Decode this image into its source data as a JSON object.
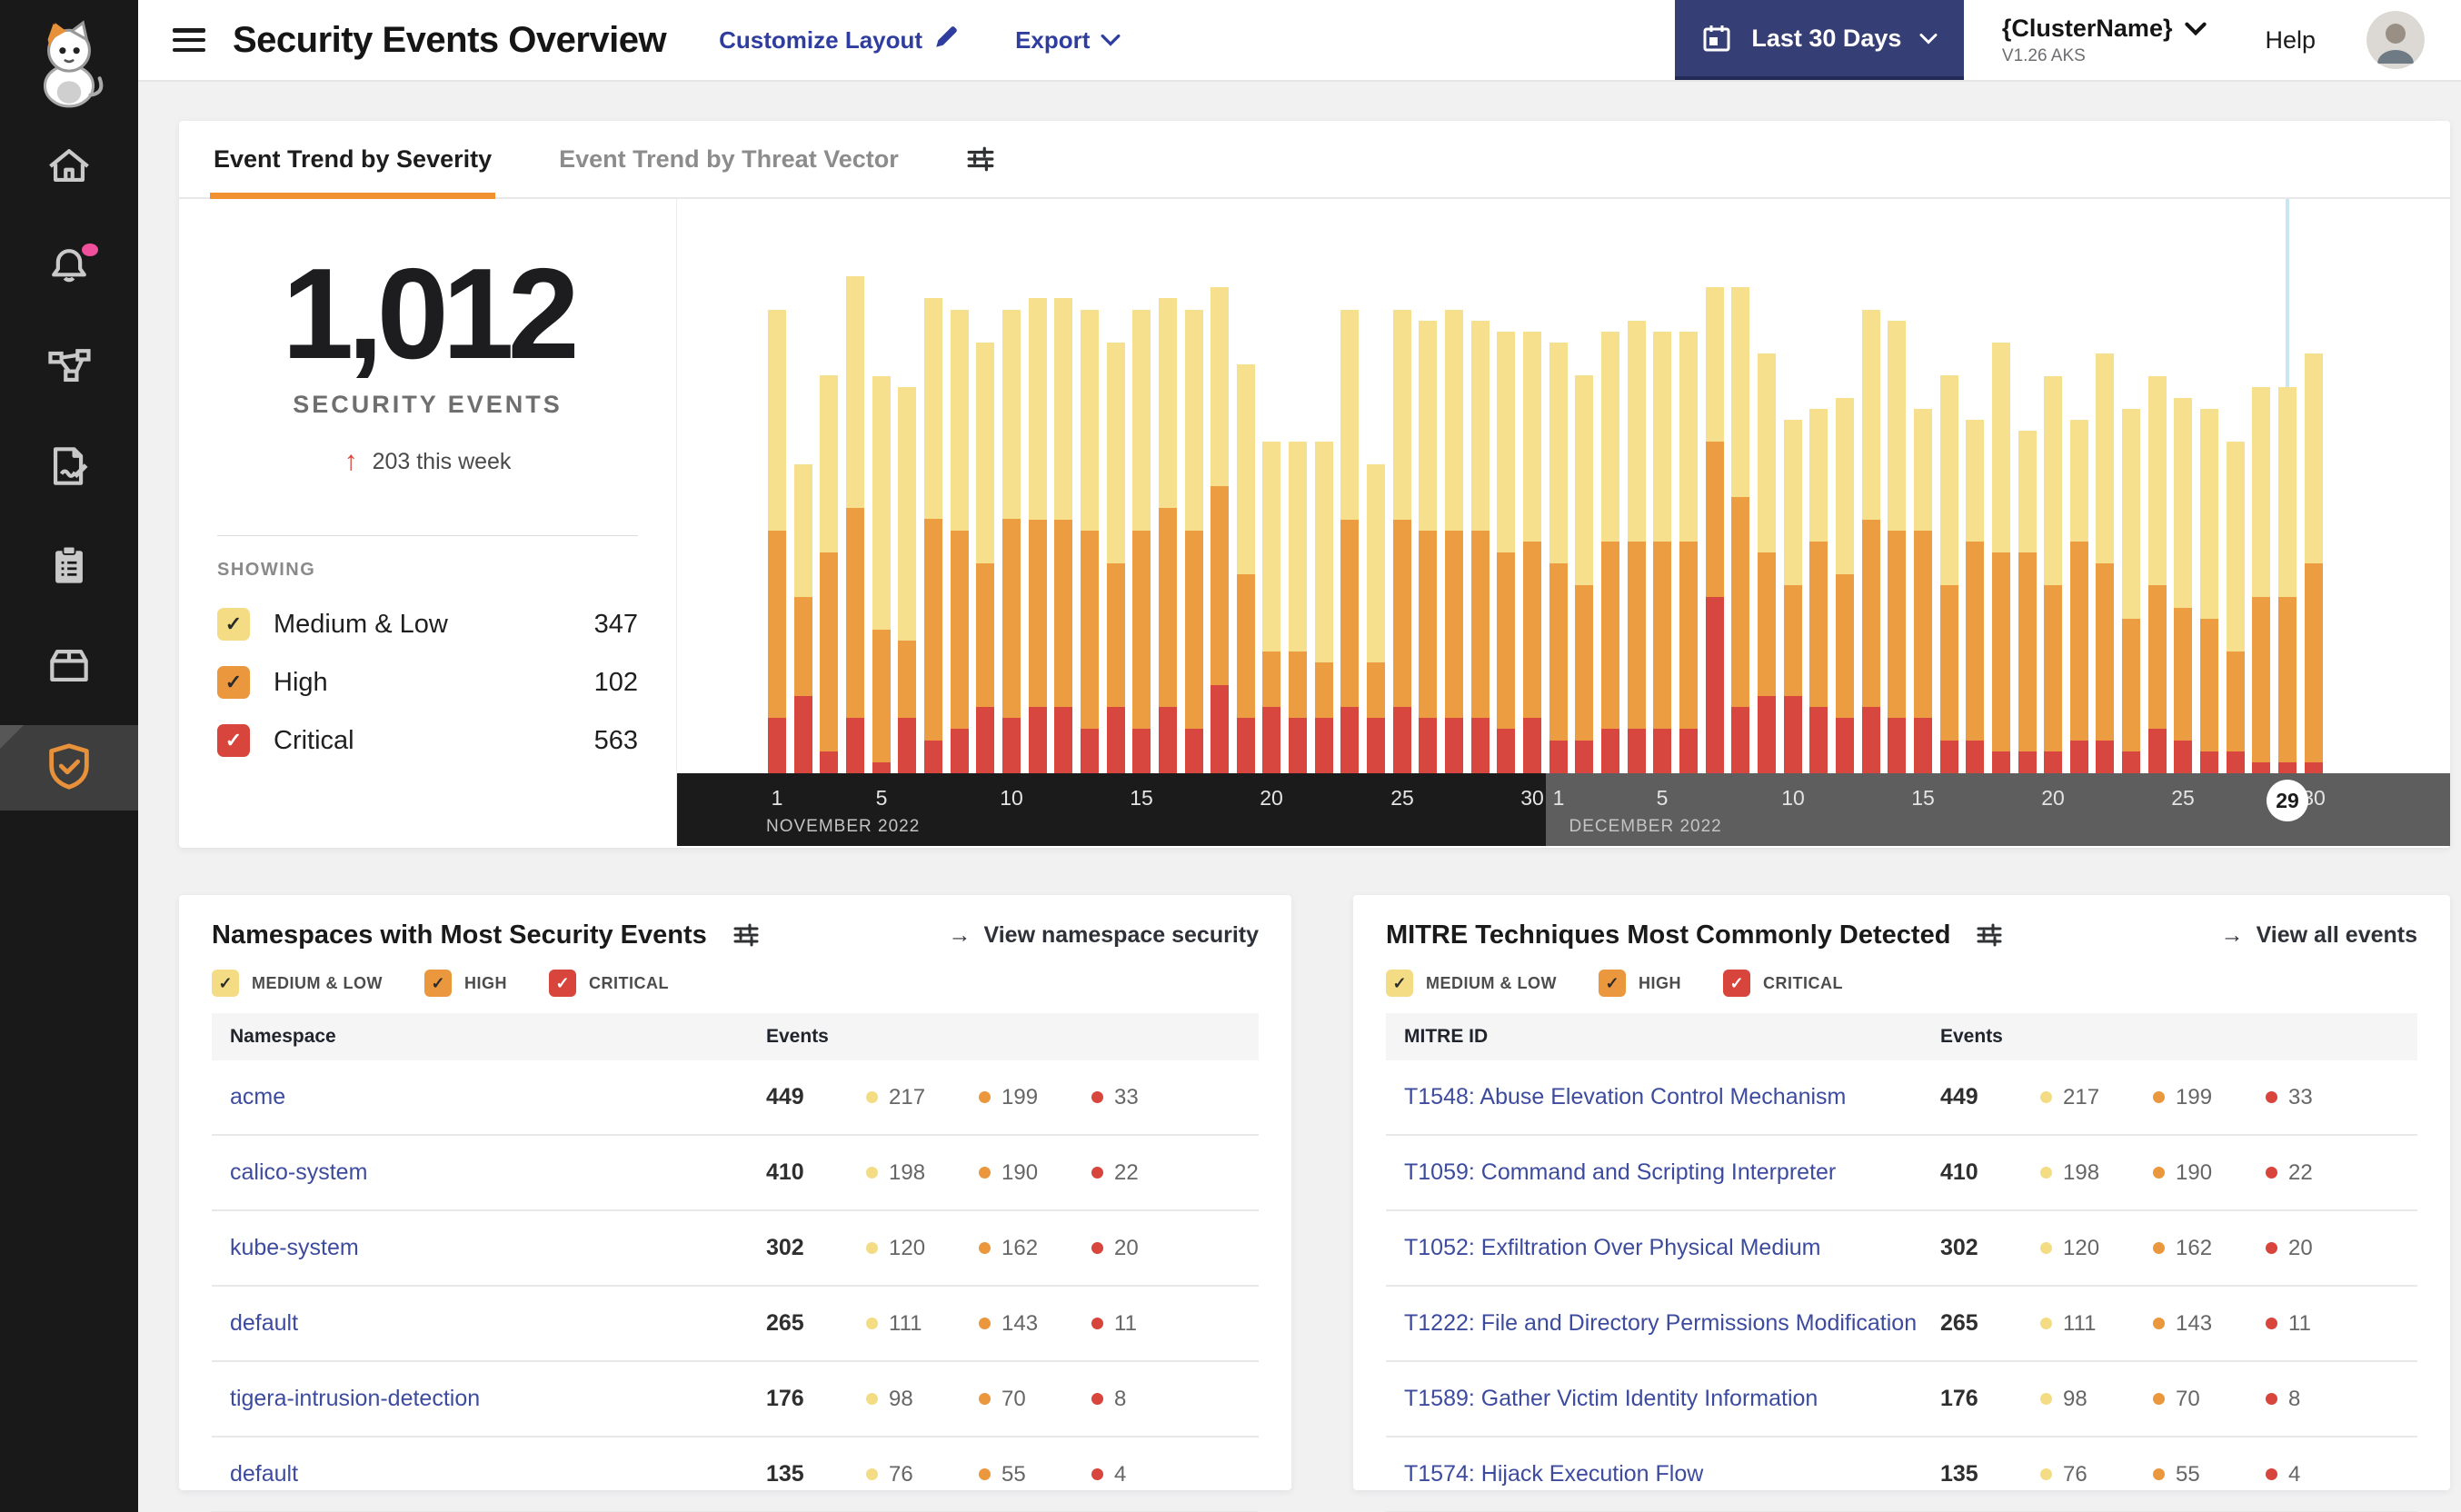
{
  "header": {
    "title": "Security Events Overview",
    "customize_label": "Customize Layout",
    "export_label": "Export",
    "date_range": "Last 30 Days",
    "cluster_name": "{ClusterName}",
    "cluster_meta": "V1.26 AKS",
    "help_label": "Help"
  },
  "colors": {
    "medium": "#F4DC85",
    "high": "#EA973D",
    "critical": "#D8453C",
    "accent_orange": "#F0902E",
    "link_indigo": "#3D4B9E",
    "button_navy": "#353E75",
    "notification_pink": "#F0509B"
  },
  "trend": {
    "tabs": [
      "Event Trend by Severity",
      "Event Trend by Threat Vector"
    ],
    "total": "1,012",
    "total_label": "SECURITY EVENTS",
    "delta_arrow": "↑",
    "delta_text": "203 this week",
    "showing_label": "SHOWING",
    "legend": [
      {
        "label": "Medium & Low",
        "value": "347",
        "color": "#F4DC85",
        "check": "#2B2B2B"
      },
      {
        "label": "High",
        "value": "102",
        "color": "#EA973D",
        "check": "#2B2B2B"
      },
      {
        "label": "Critical",
        "value": "563",
        "color": "#D8453C",
        "check": "#FFFFFF"
      }
    ]
  },
  "chart_data": {
    "type": "bar",
    "title": "Event Trend by Severity",
    "x_unit": "day",
    "ymax": 52,
    "grid": false,
    "legend_position": "left-panel",
    "series": [
      {
        "name": "Critical",
        "color": "#D7473F",
        "values": [
          5,
          7,
          2,
          5,
          1,
          5,
          3,
          4,
          6,
          5,
          6,
          6,
          4,
          6,
          4,
          6,
          4,
          8,
          5,
          6,
          5,
          5,
          6,
          5,
          6,
          5,
          5,
          5,
          4,
          5,
          3,
          3,
          4,
          4,
          4,
          4,
          16,
          6,
          7,
          7,
          6,
          5,
          6,
          5,
          5,
          3,
          3,
          2,
          2,
          2,
          3,
          3,
          2,
          4,
          3,
          2,
          2,
          1,
          1,
          1
        ]
      },
      {
        "name": "High",
        "color": "#EC9C41",
        "values": [
          17,
          9,
          18,
          19,
          12,
          7,
          20,
          18,
          13,
          18,
          17,
          17,
          18,
          13,
          18,
          18,
          18,
          18,
          13,
          5,
          6,
          5,
          17,
          5,
          17,
          17,
          17,
          17,
          16,
          16,
          16,
          14,
          17,
          17,
          17,
          17,
          14,
          19,
          13,
          10,
          15,
          13,
          17,
          17,
          17,
          14,
          18,
          18,
          18,
          15,
          18,
          16,
          12,
          13,
          12,
          12,
          9,
          15,
          15,
          18
        ]
      },
      {
        "name": "Medium & Low",
        "color": "#F6E08D",
        "values": [
          20,
          12,
          16,
          21,
          23,
          23,
          20,
          20,
          20,
          19,
          20,
          20,
          20,
          20,
          20,
          19,
          20,
          18,
          19,
          19,
          19,
          20,
          19,
          18,
          19,
          19,
          20,
          19,
          20,
          19,
          20,
          19,
          19,
          20,
          19,
          19,
          14,
          19,
          18,
          15,
          12,
          16,
          19,
          19,
          11,
          19,
          11,
          19,
          11,
          19,
          11,
          19,
          19,
          19,
          19,
          19,
          19,
          19,
          19,
          19
        ]
      }
    ],
    "months": [
      {
        "label": "NOVEMBER 2022",
        "ticks": [
          {
            "index": 0,
            "label": "1"
          },
          {
            "index": 4,
            "label": "5"
          },
          {
            "index": 9,
            "label": "10"
          },
          {
            "index": 14,
            "label": "15"
          },
          {
            "index": 19,
            "label": "20"
          },
          {
            "index": 24,
            "label": "25"
          },
          {
            "index": 29,
            "label": "30"
          }
        ]
      },
      {
        "label": "DECEMBER 2022",
        "ticks": [
          {
            "index": 30,
            "label": "1"
          },
          {
            "index": 34,
            "label": "5"
          },
          {
            "index": 39,
            "label": "10"
          },
          {
            "index": 44,
            "label": "15"
          },
          {
            "index": 49,
            "label": "20"
          },
          {
            "index": 54,
            "label": "25"
          },
          {
            "index": 59,
            "label": "30"
          }
        ]
      }
    ],
    "boundary_index": 30,
    "cursor": {
      "index": 58,
      "badge": "29"
    }
  },
  "namespaces_card": {
    "title": "Namespaces with Most Security Events",
    "link": "View namespace security",
    "arrow": "→",
    "filters": [
      {
        "label": "MEDIUM & LOW",
        "color": "#F4DC85",
        "check": "#2B2B2B"
      },
      {
        "label": "HIGH",
        "color": "#EA973D",
        "check": "#2B2B2B"
      },
      {
        "label": "CRITICAL",
        "color": "#D8453C",
        "check": "#FFFFFF"
      }
    ],
    "columns": [
      "Namespace",
      "Events"
    ],
    "rows": [
      {
        "name": "acme",
        "total": "449",
        "medium": "217",
        "high": "199",
        "critical": "33"
      },
      {
        "name": "calico-system",
        "total": "410",
        "medium": "198",
        "high": "190",
        "critical": "22"
      },
      {
        "name": "kube-system",
        "total": "302",
        "medium": "120",
        "high": "162",
        "critical": "20"
      },
      {
        "name": "default",
        "total": "265",
        "medium": "111",
        "high": "143",
        "critical": "11"
      },
      {
        "name": "tigera-intrusion-detection",
        "total": "176",
        "medium": "98",
        "high": "70",
        "critical": "8"
      },
      {
        "name": "default",
        "total": "135",
        "medium": "76",
        "high": "55",
        "critical": "4"
      }
    ]
  },
  "mitre_card": {
    "title": "MITRE Techniques Most Commonly Detected",
    "link": "View all events",
    "arrow": "→",
    "filters": [
      {
        "label": "MEDIUM & LOW",
        "color": "#F4DC85",
        "check": "#2B2B2B"
      },
      {
        "label": "HIGH",
        "color": "#EA973D",
        "check": "#2B2B2B"
      },
      {
        "label": "CRITICAL",
        "color": "#D8453C",
        "check": "#FFFFFF"
      }
    ],
    "columns": [
      "MITRE ID",
      "Events"
    ],
    "rows": [
      {
        "name": "T1548: Abuse Elevation Control Mechanism",
        "total": "449",
        "medium": "217",
        "high": "199",
        "critical": "33"
      },
      {
        "name": "T1059: Command and Scripting Interpreter",
        "total": "410",
        "medium": "198",
        "high": "190",
        "critical": "22"
      },
      {
        "name": "T1052: Exfiltration Over Physical Medium",
        "total": "302",
        "medium": "120",
        "high": "162",
        "critical": "20"
      },
      {
        "name": "T1222: File and Directory Permissions Modification",
        "total": "265",
        "medium": "111",
        "high": "143",
        "critical": "11"
      },
      {
        "name": "T1589: Gather Victim Identity Information",
        "total": "176",
        "medium": "98",
        "high": "70",
        "critical": "8"
      },
      {
        "name": "T1574: Hijack Execution Flow",
        "total": "135",
        "medium": "76",
        "high": "55",
        "critical": "4"
      }
    ]
  }
}
